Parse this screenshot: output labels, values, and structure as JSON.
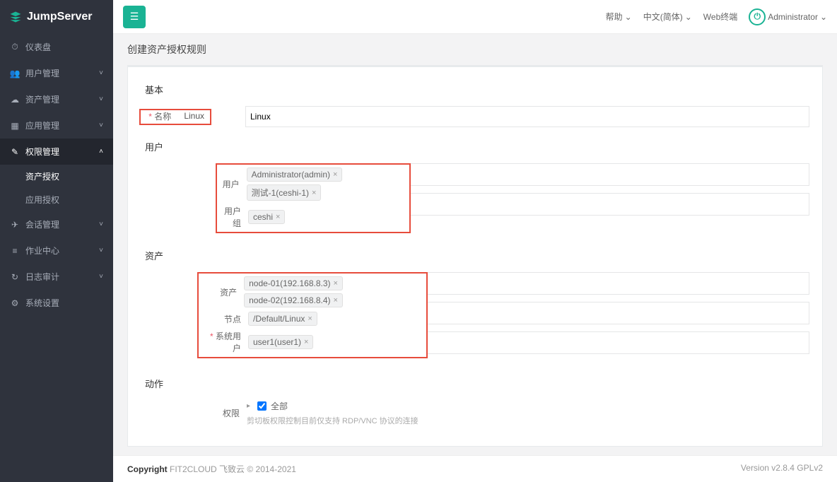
{
  "brand": "JumpServer",
  "topbar": {
    "help": "帮助",
    "lang": "中文(简体)",
    "webterm": "Web终端",
    "user": "Administrator"
  },
  "sidebar": {
    "items": [
      {
        "icon": "⏱",
        "label": "仪表盘",
        "chev": false
      },
      {
        "icon": "👥",
        "label": "用户管理",
        "chev": true
      },
      {
        "icon": "☁",
        "label": "资产管理",
        "chev": true
      },
      {
        "icon": "▦",
        "label": "应用管理",
        "chev": true
      },
      {
        "icon": "✎",
        "label": "权限管理",
        "chev": true,
        "active": true,
        "sub": [
          {
            "label": "资产授权",
            "selected": true
          },
          {
            "label": "应用授权"
          }
        ]
      },
      {
        "icon": "✈",
        "label": "会话管理",
        "chev": true
      },
      {
        "icon": "≡",
        "label": "作业中心",
        "chev": true
      },
      {
        "icon": "↻",
        "label": "日志审计",
        "chev": true
      },
      {
        "icon": "⚙",
        "label": "系统设置",
        "chev": false
      }
    ]
  },
  "page": {
    "title": "创建资产授权规则"
  },
  "sections": {
    "basic": {
      "title": "基本",
      "name_label": "名称",
      "name_value": "Linux"
    },
    "user": {
      "title": "用户",
      "user_label": "用户",
      "user_tags": [
        "Administrator(admin)",
        "测试-1(ceshi-1)"
      ],
      "group_label": "用户组",
      "group_tags": [
        "ceshi"
      ]
    },
    "asset": {
      "title": "资产",
      "asset_label": "资产",
      "asset_tags": [
        "node-01(192.168.8.3)",
        "node-02(192.168.8.4)"
      ],
      "node_label": "节点",
      "node_tags": [
        "/Default/Linux"
      ],
      "sysuser_label": "系统用户",
      "sysuser_tags": [
        "user1(user1)"
      ]
    },
    "action": {
      "title": "动作",
      "perm_label": "权限",
      "all_label": "全部",
      "help": "剪切板权限控制目前仅支持 RDP/VNC 协议的连接"
    }
  },
  "footer": {
    "copyright": "Copyright",
    "org": "FIT2CLOUD 飞致云 © 2014-2021",
    "version": "Version v2.8.4 GPLv2"
  }
}
